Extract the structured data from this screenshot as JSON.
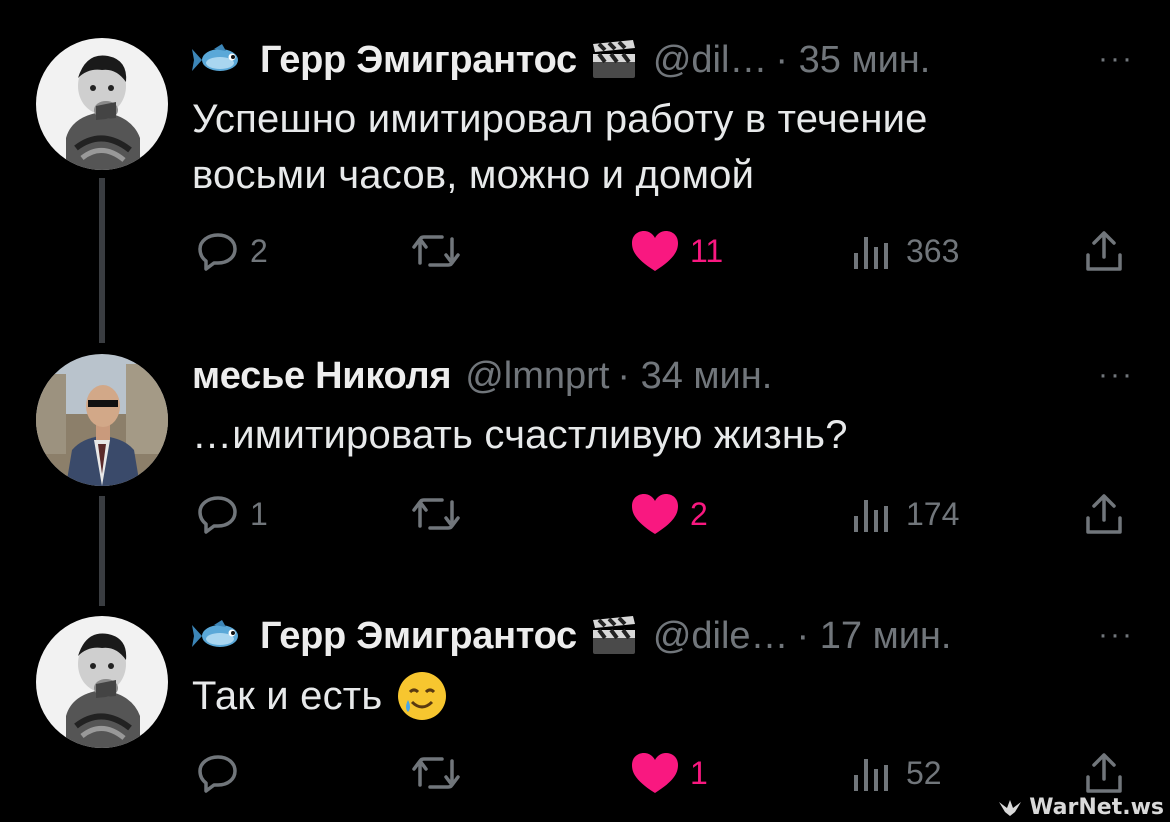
{
  "colors": {
    "background": "#000000",
    "text": "#e7e9ea",
    "muted": "#71767b",
    "like": "#f91880",
    "thread_line": "#3a3d41"
  },
  "tweets": [
    {
      "name": "Герр Эмигрантос",
      "handle": "@dil…",
      "time": "· 35 мин.",
      "more": "···",
      "text_lines": [
        "Успешно имитировал работу в течение",
        "восьми часов, можно и домой"
      ],
      "replies": "2",
      "retweets": "",
      "likes": "11",
      "views": "363",
      "avatar": "child-photo-avatar",
      "name_prefix_icon": "fish-emoji-icon",
      "name_suffix_icon": "clapper-board-emoji-icon"
    },
    {
      "name": "месье Николя",
      "handle": "@lmnprt",
      "time": "· 34 мин.",
      "more": "···",
      "text_lines": [
        "…имитировать счастливую жизнь?"
      ],
      "replies": "1",
      "retweets": "",
      "likes": "2",
      "views": "174",
      "avatar": "man-in-suit-avatar"
    },
    {
      "name": "Герр Эмигрантос",
      "handle": "@dile…",
      "time": "· 17 мин.",
      "more": "···",
      "text_lines": [
        "Так и есть"
      ],
      "replies": "",
      "retweets": "",
      "likes": "1",
      "views": "52",
      "avatar": "child-photo-avatar",
      "name_prefix_icon": "fish-emoji-icon",
      "name_suffix_icon": "clapper-board-emoji-icon",
      "text_emoji": "smiling-face-with-tear-emoji-icon"
    }
  ],
  "watermark": "WarNet.ws"
}
